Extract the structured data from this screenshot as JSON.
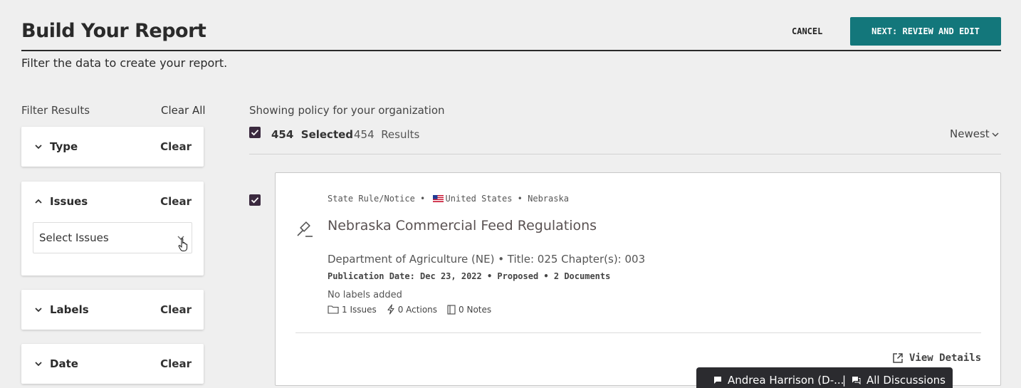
{
  "header": {
    "title": "Build Your Report",
    "subtitle": "Filter the data to create your report.",
    "cancel_label": "CANCEL",
    "next_label": "NEXT: REVIEW AND EDIT",
    "accent_color": "#13777b"
  },
  "filters": {
    "label": "Filter Results",
    "clear_all": "Clear All",
    "items": [
      {
        "title": "Type",
        "clear": "Clear",
        "expanded": false
      },
      {
        "title": "Issues",
        "clear": "Clear",
        "expanded": true,
        "select_placeholder": "Select Issues"
      },
      {
        "title": "Labels",
        "clear": "Clear",
        "expanded": false
      },
      {
        "title": "Date",
        "clear": "Clear",
        "expanded": false
      }
    ]
  },
  "results": {
    "showing_text": "Showing policy for your organization",
    "selected_count": "454",
    "selected_label": "Selected",
    "results_count": "454",
    "results_label": "Results",
    "sort_label": "Newest",
    "checkbox_color": "#3b2a3f"
  },
  "policy": {
    "type": "State Rule/Notice",
    "country": "United States",
    "state": "Nebraska",
    "title": "Nebraska Commercial Feed Regulations",
    "department_line": "Department of Agriculture (NE) • Title: 025 Chapter(s): 003",
    "publication_line": "Publication Date: Dec 23, 2022 • Proposed • 2 Documents",
    "labels_text": "No labels added",
    "issues": "1 Issues",
    "actions": "0 Actions",
    "notes": "0 Notes",
    "view_details": "View Details",
    "icon": "gavel-icon",
    "selected": true
  },
  "discussions": {
    "item1": "Andrea Harrison (D-...",
    "separator": "|",
    "item2": "All Discussions"
  }
}
